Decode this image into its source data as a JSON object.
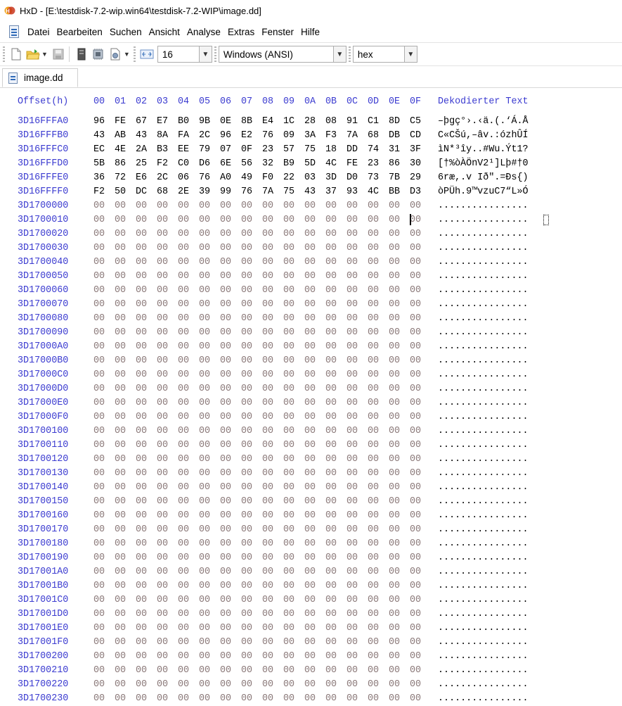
{
  "window": {
    "title": "HxD - [E:\\testdisk-7.2-wip.win64\\testdisk-7.2-WIP\\image.dd]"
  },
  "menu": {
    "items": [
      "Datei",
      "Bearbeiten",
      "Suchen",
      "Ansicht",
      "Analyse",
      "Extras",
      "Fenster",
      "Hilfe"
    ]
  },
  "toolbar": {
    "icons": [
      "new-file-icon",
      "open-folder-icon",
      "save-disk-icon",
      "open-disk-icon",
      "open-ram-icon",
      "properties-icon",
      "bytes-per-row-icon"
    ],
    "bytes_per_row": "16",
    "charset": "Windows (ANSI)",
    "offset_base": "hex"
  },
  "tab": {
    "label": "image.dd"
  },
  "hex": {
    "offset_header": "Offset(h)",
    "column_headers": [
      "00",
      "01",
      "02",
      "03",
      "04",
      "05",
      "06",
      "07",
      "08",
      "09",
      "0A",
      "0B",
      "0C",
      "0D",
      "0E",
      "0F"
    ],
    "text_header": "Dekodierter Text",
    "rows": [
      {
        "offset": "3D16FFFA0",
        "bytes": [
          "96",
          "FE",
          "67",
          "E7",
          "B0",
          "9B",
          "0E",
          "8B",
          "E4",
          "1C",
          "28",
          "08",
          "91",
          "C1",
          "8D",
          "C5"
        ],
        "text": "–þgç°›.‹ä.(.‘Á.Å"
      },
      {
        "offset": "3D16FFFB0",
        "bytes": [
          "43",
          "AB",
          "43",
          "8A",
          "FA",
          "2C",
          "96",
          "E2",
          "76",
          "09",
          "3A",
          "F3",
          "7A",
          "68",
          "DB",
          "CD"
        ],
        "text": "C«CŠú,–âv.:ózhÛÍ"
      },
      {
        "offset": "3D16FFFC0",
        "bytes": [
          "EC",
          "4E",
          "2A",
          "B3",
          "EE",
          "79",
          "07",
          "0F",
          "23",
          "57",
          "75",
          "18",
          "DD",
          "74",
          "31",
          "3F"
        ],
        "text": "ìN*³îy..#Wu.Ýt1?"
      },
      {
        "offset": "3D16FFFD0",
        "bytes": [
          "5B",
          "86",
          "25",
          "F2",
          "C0",
          "D6",
          "6E",
          "56",
          "32",
          "B9",
          "5D",
          "4C",
          "FE",
          "23",
          "86",
          "30"
        ],
        "text": "[†%òÀÖnV2¹]Lþ#†0"
      },
      {
        "offset": "3D16FFFE0",
        "bytes": [
          "36",
          "72",
          "E6",
          "2C",
          "06",
          "76",
          "A0",
          "49",
          "F0",
          "22",
          "03",
          "3D",
          "D0",
          "73",
          "7B",
          "29"
        ],
        "text": "6ræ,.v Ið\".=Ðs{)"
      },
      {
        "offset": "3D16FFFF0",
        "bytes": [
          "F2",
          "50",
          "DC",
          "68",
          "2E",
          "39",
          "99",
          "76",
          "7A",
          "75",
          "43",
          "37",
          "93",
          "4C",
          "BB",
          "D3"
        ],
        "text": "òPÜh.9™vzuC7“L»Ó"
      },
      {
        "offset": "3D1700000",
        "zero": true
      },
      {
        "offset": "3D1700010",
        "zero": true
      },
      {
        "offset": "3D1700020",
        "zero": true
      },
      {
        "offset": "3D1700030",
        "zero": true
      },
      {
        "offset": "3D1700040",
        "zero": true
      },
      {
        "offset": "3D1700050",
        "zero": true
      },
      {
        "offset": "3D1700060",
        "zero": true
      },
      {
        "offset": "3D1700070",
        "zero": true
      },
      {
        "offset": "3D1700080",
        "zero": true
      },
      {
        "offset": "3D1700090",
        "zero": true
      },
      {
        "offset": "3D17000A0",
        "zero": true
      },
      {
        "offset": "3D17000B0",
        "zero": true
      },
      {
        "offset": "3D17000C0",
        "zero": true
      },
      {
        "offset": "3D17000D0",
        "zero": true
      },
      {
        "offset": "3D17000E0",
        "zero": true
      },
      {
        "offset": "3D17000F0",
        "zero": true
      },
      {
        "offset": "3D1700100",
        "zero": true
      },
      {
        "offset": "3D1700110",
        "zero": true
      },
      {
        "offset": "3D1700120",
        "zero": true
      },
      {
        "offset": "3D1700130",
        "zero": true
      },
      {
        "offset": "3D1700140",
        "zero": true
      },
      {
        "offset": "3D1700150",
        "zero": true
      },
      {
        "offset": "3D1700160",
        "zero": true
      },
      {
        "offset": "3D1700170",
        "zero": true
      },
      {
        "offset": "3D1700180",
        "zero": true
      },
      {
        "offset": "3D1700190",
        "zero": true
      },
      {
        "offset": "3D17001A0",
        "zero": true
      },
      {
        "offset": "3D17001B0",
        "zero": true
      },
      {
        "offset": "3D17001C0",
        "zero": true
      },
      {
        "offset": "3D17001D0",
        "zero": true
      },
      {
        "offset": "3D17001E0",
        "zero": true
      },
      {
        "offset": "3D17001F0",
        "zero": true
      },
      {
        "offset": "3D1700200",
        "zero": true
      },
      {
        "offset": "3D1700210",
        "zero": true
      },
      {
        "offset": "3D1700220",
        "zero": true
      },
      {
        "offset": "3D1700230",
        "zero": true
      }
    ],
    "zero_byte": "00",
    "zero_text": "................"
  },
  "colors": {
    "offset_blue": "#3b3bd0",
    "zero_byte": "#8a7878",
    "data_byte": "#000000"
  }
}
